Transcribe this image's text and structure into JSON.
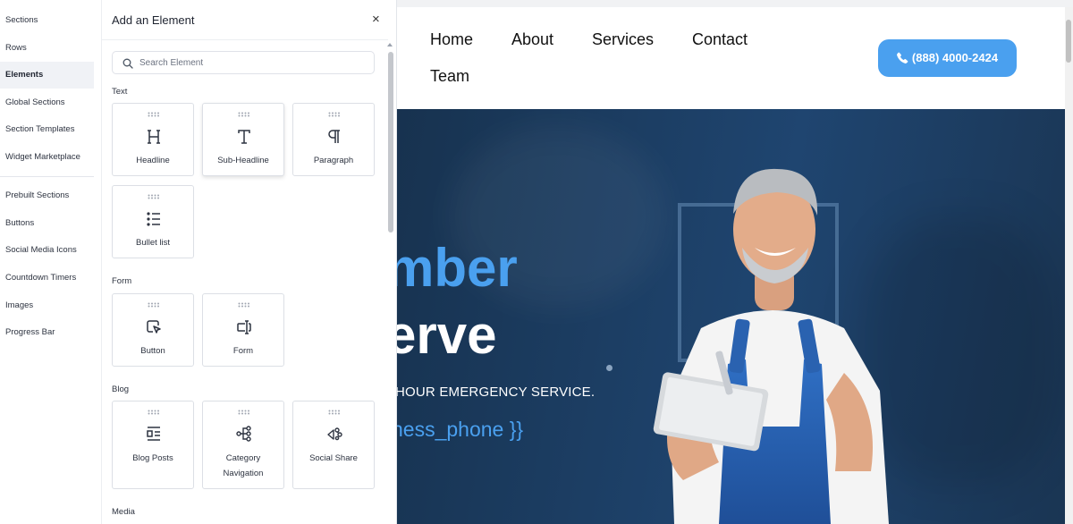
{
  "sidebar": {
    "items": [
      {
        "label": "Sections",
        "active": false
      },
      {
        "label": "Rows",
        "active": false
      },
      {
        "label": "Elements",
        "active": true
      },
      {
        "label": "Global Sections",
        "active": false
      },
      {
        "label": "Section Templates",
        "active": false
      },
      {
        "label": "Widget Marketplace",
        "active": false
      },
      {
        "label": "Prebuilt Sections",
        "active": false
      },
      {
        "label": "Buttons",
        "active": false
      },
      {
        "label": "Social Media Icons",
        "active": false
      },
      {
        "label": "Countdown Timers",
        "active": false
      },
      {
        "label": "Images",
        "active": false
      },
      {
        "label": "Progress Bar",
        "active": false
      }
    ]
  },
  "panel": {
    "title": "Add an Element",
    "close_icon": "×",
    "search": {
      "placeholder": "Search Element",
      "value": ""
    },
    "groups": [
      {
        "label": "Text",
        "elements": [
          {
            "label": "Headline",
            "icon": "headline-icon"
          },
          {
            "label": "Sub-Headline",
            "icon": "sub-headline-icon"
          },
          {
            "label": "Paragraph",
            "icon": "paragraph-icon"
          },
          {
            "label": "Bullet list",
            "icon": "bullet-list-icon"
          }
        ]
      },
      {
        "label": "Form",
        "elements": [
          {
            "label": "Button",
            "icon": "button-cursor-icon"
          },
          {
            "label": "Form",
            "icon": "form-input-icon"
          }
        ]
      },
      {
        "label": "Blog",
        "elements": [
          {
            "label": "Blog Posts",
            "icon": "blog-posts-icon"
          },
          {
            "label": "Category Navigation",
            "label_lines": [
              "Category",
              "Navigation"
            ],
            "icon": "category-navigation-icon"
          },
          {
            "label": "Social Share",
            "icon": "social-share-icon"
          }
        ]
      },
      {
        "label": "Media",
        "elements": []
      }
    ]
  },
  "site": {
    "menu": [
      "Home",
      "About",
      "Services",
      "Contact",
      "Team"
    ],
    "phone_button": "(888) 4000-2424",
    "hero": {
      "line1": "mber",
      "line2": "erve",
      "subline": "HOUR EMERGENCY SERVICE.",
      "phone_template": "ness_phone }}"
    }
  },
  "colors": {
    "accent": "#4aa0ef",
    "hero_bg": "#1b3a5c",
    "active_nav_bg": "#f0f2f6"
  }
}
